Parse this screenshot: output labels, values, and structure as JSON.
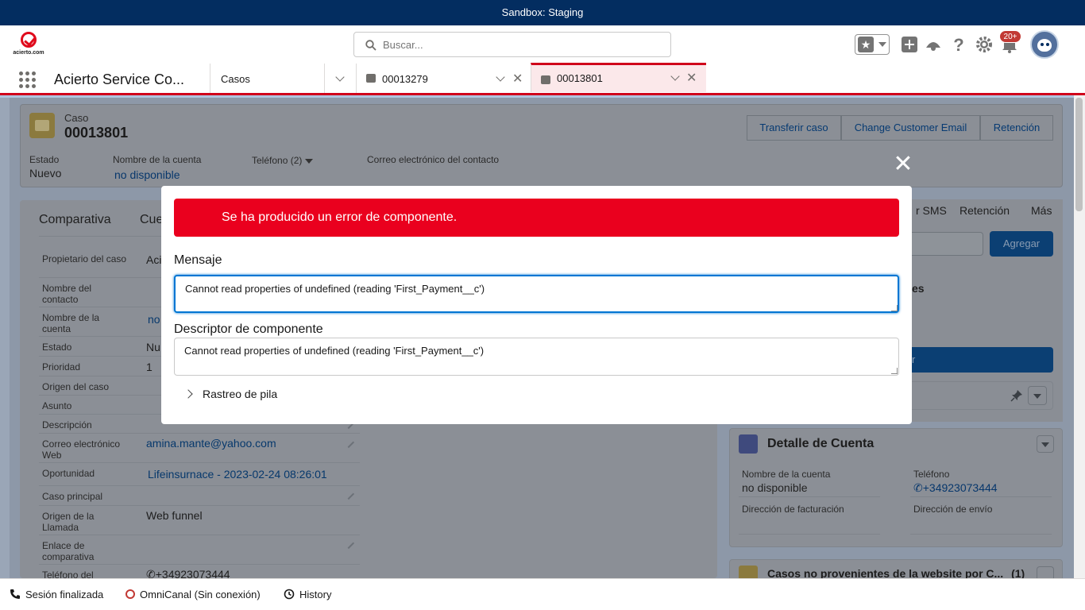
{
  "sandbox": {
    "label": "Sandbox: Staging"
  },
  "header": {
    "logo_text": "acierto.com",
    "search_placeholder": "Buscar...",
    "notifications_badge": "20+"
  },
  "nav": {
    "app_name": "Acierto Service Co...",
    "tabs": [
      {
        "label": "Casos"
      },
      {
        "label": "00013279"
      },
      {
        "label": "00013801"
      }
    ]
  },
  "record": {
    "type_label": "Caso",
    "number": "00013801",
    "buttons": [
      "Transferir caso",
      "Change Customer Email",
      "Retención"
    ],
    "highlights": [
      {
        "label": "Estado",
        "value": "Nuevo"
      },
      {
        "label": "Nombre de la cuenta",
        "value": "no disponible"
      },
      {
        "label": "Teléfono (2)",
        "value": ""
      },
      {
        "label": "Correo electrónico del contacto",
        "value": ""
      }
    ]
  },
  "left_tabs": [
    "Comparativa",
    "Cue"
  ],
  "fields": [
    {
      "label": "Propietario del caso",
      "value": "Aci"
    },
    {
      "label": "Nombre del contacto",
      "value": ""
    },
    {
      "label": "Nombre de la cuenta",
      "value": "no"
    },
    {
      "label": "Estado",
      "value": "Nu"
    },
    {
      "label": "Prioridad",
      "value": "1"
    },
    {
      "label": "Origen del caso",
      "value": ""
    },
    {
      "label": "Asunto",
      "value": ""
    },
    {
      "label": "Descripción",
      "value": ""
    },
    {
      "label": "Correo electrónico Web",
      "value": "amina.mante@yahoo.com"
    },
    {
      "label": "Oportunidad",
      "value": "Lifeinsurnace - 2023-02-24 08:26:01"
    },
    {
      "label": "Caso principal",
      "value": ""
    },
    {
      "label": "Origen de la Llamada",
      "value": "Web funnel"
    },
    {
      "label": "Enlace de comparativa",
      "value": ""
    },
    {
      "label": "Teléfono del",
      "value": "+34923073444"
    }
  ],
  "right_tabs": [
    "r SMS",
    "Retención",
    "Más"
  ],
  "right_panel": {
    "add_button": "Agregar",
    "card_title_fragment": "es",
    "button_fragment": "r"
  },
  "account_detail": {
    "title": "Detalle de Cuenta",
    "fields": [
      {
        "label": "Nombre de la cuenta",
        "value": "no disponible"
      },
      {
        "label": "Teléfono",
        "value": "+34923073444"
      },
      {
        "label": "Dirección de facturación",
        "value": ""
      },
      {
        "label": "Dirección de envío",
        "value": ""
      }
    ]
  },
  "related_card": {
    "title": "Casos no provenientes de la website por C...",
    "count": "(1)"
  },
  "modal": {
    "error_title": "Se ha producido un error de componente.",
    "message_label": "Mensaje",
    "message_value": "Cannot read properties of undefined (reading 'First_Payment__c')",
    "descriptor_label": "Descriptor de componente",
    "descriptor_value": "Cannot read properties of undefined (reading 'First_Payment__c')",
    "stack_label": "Rastreo de pila"
  },
  "utility_bar": {
    "phone_status": "Sesión finalizada",
    "omni_status": "OmniCanal (Sin conexión)",
    "history": "History"
  },
  "colors": {
    "brand_red": "#ea001e",
    "link_blue": "#0176d3",
    "header_navy": "#032d60"
  }
}
